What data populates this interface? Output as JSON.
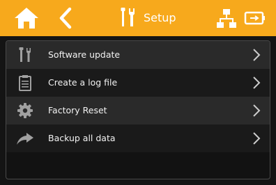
{
  "header": {
    "title": "Setup",
    "icons": {
      "home": "home-icon",
      "back": "back-chevron-icon",
      "tools": "tools-icon",
      "network": "network-icon",
      "battery": "battery-charging-icon"
    }
  },
  "menu": {
    "items": [
      {
        "label": "Software update",
        "icon": "tools-icon"
      },
      {
        "label": "Create a log file",
        "icon": "clipboard-icon"
      },
      {
        "label": "Factory Reset",
        "icon": "gear-icon"
      },
      {
        "label": "Backup all data",
        "icon": "share-arrow-icon"
      }
    ]
  },
  "colors": {
    "accent": "#f7a91c",
    "background": "#141414",
    "row_alt": "#2a2a2a",
    "icon_gray": "#a0a0a0"
  }
}
